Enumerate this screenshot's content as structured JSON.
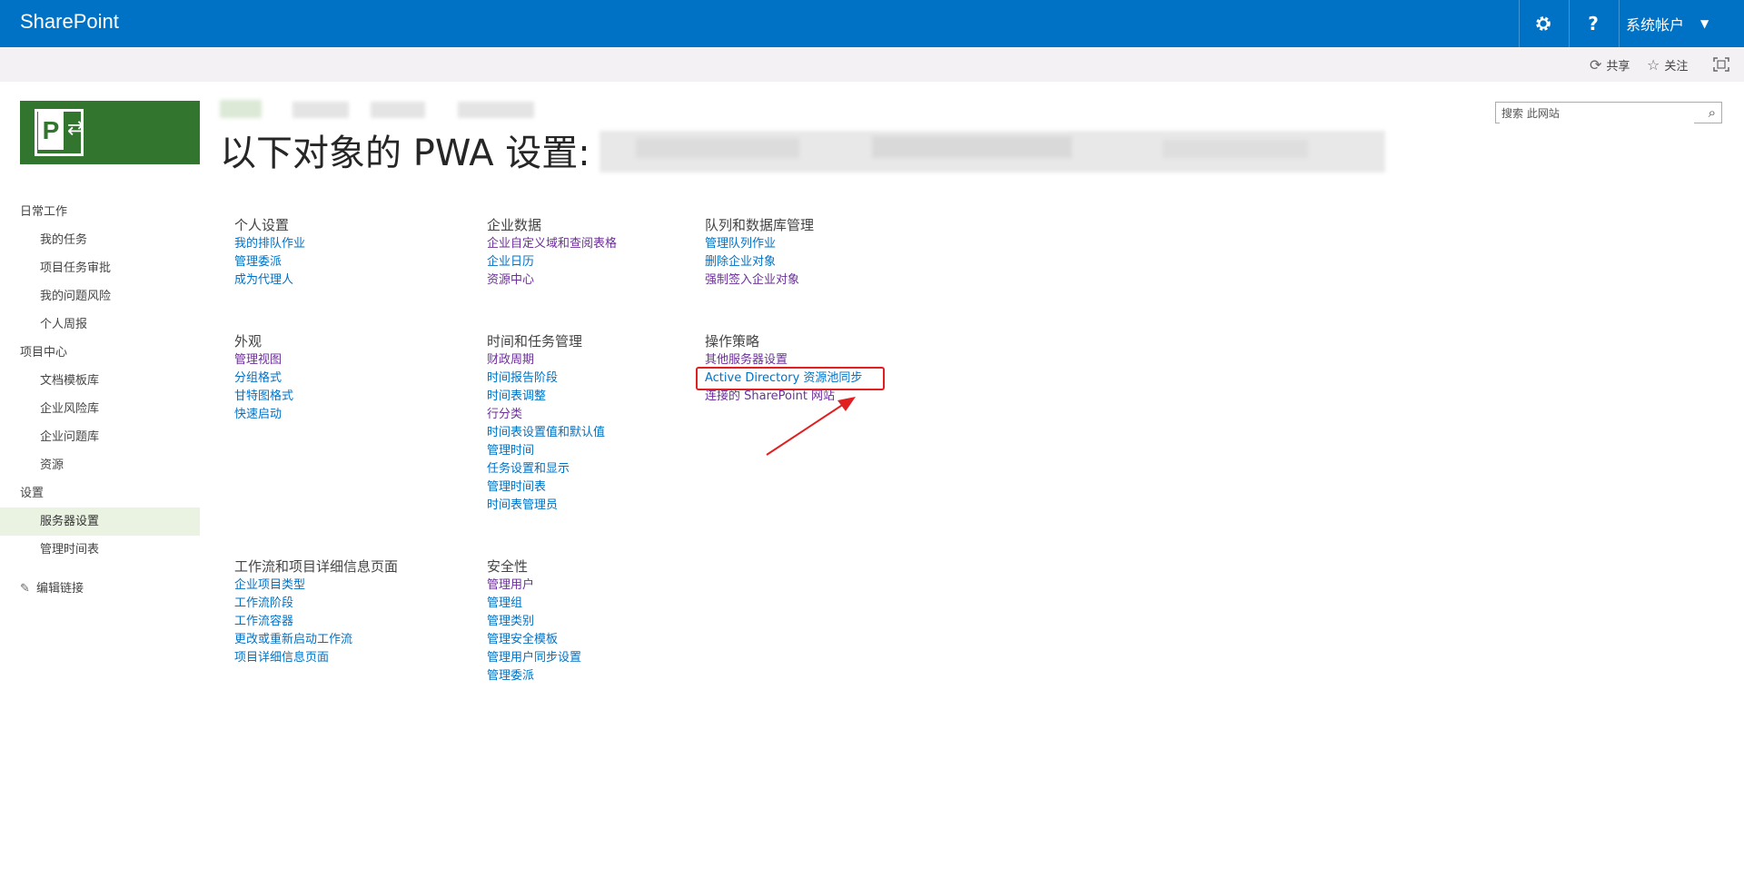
{
  "topbar": {
    "brand": "SharePoint",
    "settings_icon": "gear-icon",
    "help_label": "?",
    "user_label": "系统帐户"
  },
  "subbar": {
    "share_label": "共享",
    "follow_label": "关注",
    "focus_icon": "focus-frame-icon"
  },
  "logo": {
    "letter": "P"
  },
  "title": {
    "prefix": "以下对象的 PWA 设置:"
  },
  "search": {
    "placeholder": "搜索 此网站"
  },
  "nav": {
    "sections": [
      {
        "label": "日常工作",
        "items": [
          "我的任务",
          "项目任务审批",
          "我的问题风险",
          "个人周报"
        ]
      },
      {
        "label": "项目中心",
        "items": [
          "文档模板库",
          "企业风险库",
          "企业问题库",
          "资源"
        ]
      },
      {
        "label": "设置",
        "items": [
          "服务器设置",
          "管理时间表"
        ]
      }
    ],
    "selected": "服务器设置",
    "edit_label": "编辑链接"
  },
  "groups": [
    {
      "heading": "个人设置",
      "links": [
        "我的排队作业",
        "管理委派",
        "成为代理人"
      ]
    },
    {
      "heading": "企业数据",
      "links": [
        "企业自定义域和查阅表格",
        "企业日历",
        "资源中心"
      ]
    },
    {
      "heading": "队列和数据库管理",
      "links": [
        "管理队列作业",
        "删除企业对象",
        "强制签入企业对象"
      ]
    },
    {
      "heading": "外观",
      "links": [
        "管理视图",
        "分组格式",
        "甘特图格式",
        "快速启动"
      ]
    },
    {
      "heading": "时间和任务管理",
      "links": [
        "财政周期",
        "时间报告阶段",
        "时间表调整",
        "行分类",
        "时间表设置值和默认值",
        "管理时间",
        "任务设置和显示",
        "管理时间表",
        "时间表管理员"
      ]
    },
    {
      "heading": "操作策略",
      "links": [
        "其他服务器设置",
        "Active Directory 资源池同步",
        "连接的 SharePoint 网站"
      ]
    },
    {
      "heading": "工作流和项目详细信息页面",
      "links": [
        "企业项目类型",
        "工作流阶段",
        "工作流容器",
        "更改或重新启动工作流",
        "项目详细信息页面"
      ]
    },
    {
      "heading": "安全性",
      "links": [
        "管理用户",
        "管理组",
        "管理类别",
        "管理安全模板",
        "管理用户同步设置",
        "管理委派"
      ]
    }
  ],
  "colors": {
    "topbar": "#0072c6",
    "link": "#0072c6",
    "visited_link": "#6b2f9a",
    "logo": "#31752f",
    "highlight": "#e02020"
  }
}
